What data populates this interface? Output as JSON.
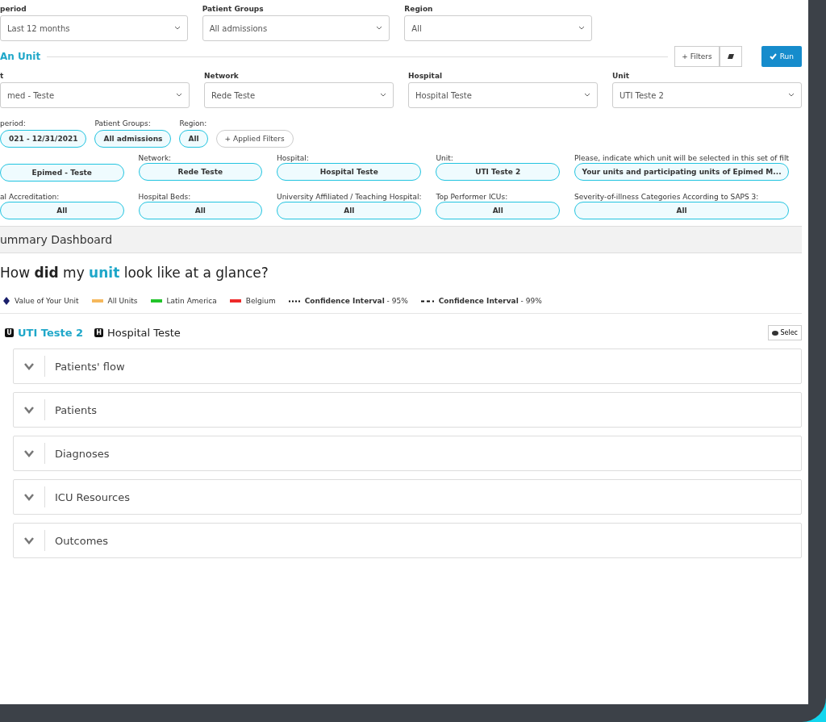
{
  "top_filters": [
    {
      "label": "period",
      "value": "Last 12 months"
    },
    {
      "label": "Patient Groups",
      "value": "All admissions"
    },
    {
      "label": "Region",
      "value": "All"
    }
  ],
  "unit_section": {
    "title": "An Unit"
  },
  "toolbar": {
    "filters_button": "+ Filters",
    "run_button": "Run"
  },
  "unit_filters": [
    {
      "label": "t",
      "value": "med - Teste"
    },
    {
      "label": "Network",
      "value": "Rede Teste"
    },
    {
      "label": "Hospital",
      "value": "Hospital Teste"
    },
    {
      "label": "Unit",
      "value": "UTI Teste 2"
    }
  ],
  "applied": [
    {
      "label": "period:",
      "value": "021 - 12/31/2021"
    },
    {
      "label": "Patient Groups:",
      "value": "All admissions"
    },
    {
      "label": "Region:",
      "value": "All"
    }
  ],
  "applied_filters_button": "+ Applied Filters",
  "chips": [
    {
      "value": "Epimed - Teste"
    },
    {
      "label": "Network:",
      "value": "Rede Teste"
    },
    {
      "label": "Hospital:",
      "value": "Hospital Teste"
    },
    {
      "label": "Unit:",
      "value": "UTI Teste 2"
    },
    {
      "label": "Please, indicate which unit will be selected in this set of filt",
      "value": "Your units and participating units of Epimed M..."
    },
    {
      "label": "al Accreditation:",
      "value": "All"
    },
    {
      "label": "Hospital Beds:",
      "value": "All"
    },
    {
      "label": "University Affiliated / Teaching Hospital:",
      "value": "All"
    },
    {
      "label": "Top Performer ICUs:",
      "value": "All"
    },
    {
      "label": "Severity-of-illness Categories According to SAPS 3:",
      "value": "All"
    }
  ],
  "summary_header": "ummary Dashboard",
  "question": [
    {
      "kind": "plain",
      "text": "How "
    },
    {
      "kind": "bold",
      "text": "did"
    },
    {
      "kind": "plain",
      "text": " my "
    },
    {
      "kind": "accent",
      "text": "unit"
    },
    {
      "kind": "plain",
      "text": " look like at a glance?"
    }
  ],
  "legend": [
    {
      "kind": "diamond",
      "color": "#1a1f6b",
      "text": "Value of Your Unit"
    },
    {
      "kind": "bar",
      "color": "#f5b85c",
      "text": "All Units"
    },
    {
      "kind": "bar",
      "color": "#22c42a",
      "text": "Latin America"
    },
    {
      "kind": "bar",
      "color": "#ee2a2a",
      "text": "Belgium"
    },
    {
      "kind": "dotted",
      "text": "**Confidence Interval** - 95%"
    },
    {
      "kind": "dashed",
      "text": "**Confidence Interval** - 99%"
    }
  ],
  "breadcrumb": [
    {
      "kind": "unit",
      "badge": "U",
      "text": "UTI Teste 2"
    },
    {
      "kind": "hospital",
      "badge": "H",
      "text": "Hospital Teste"
    }
  ],
  "select_button": "Selec",
  "sections": [
    {
      "title": "Patients' flow",
      "expanded": false
    },
    {
      "title": "Patients",
      "expanded": false
    },
    {
      "title": "Diagnoses",
      "expanded": false
    },
    {
      "title": "ICU Resources",
      "expanded": false
    },
    {
      "title": "Outcomes",
      "expanded": false
    }
  ]
}
